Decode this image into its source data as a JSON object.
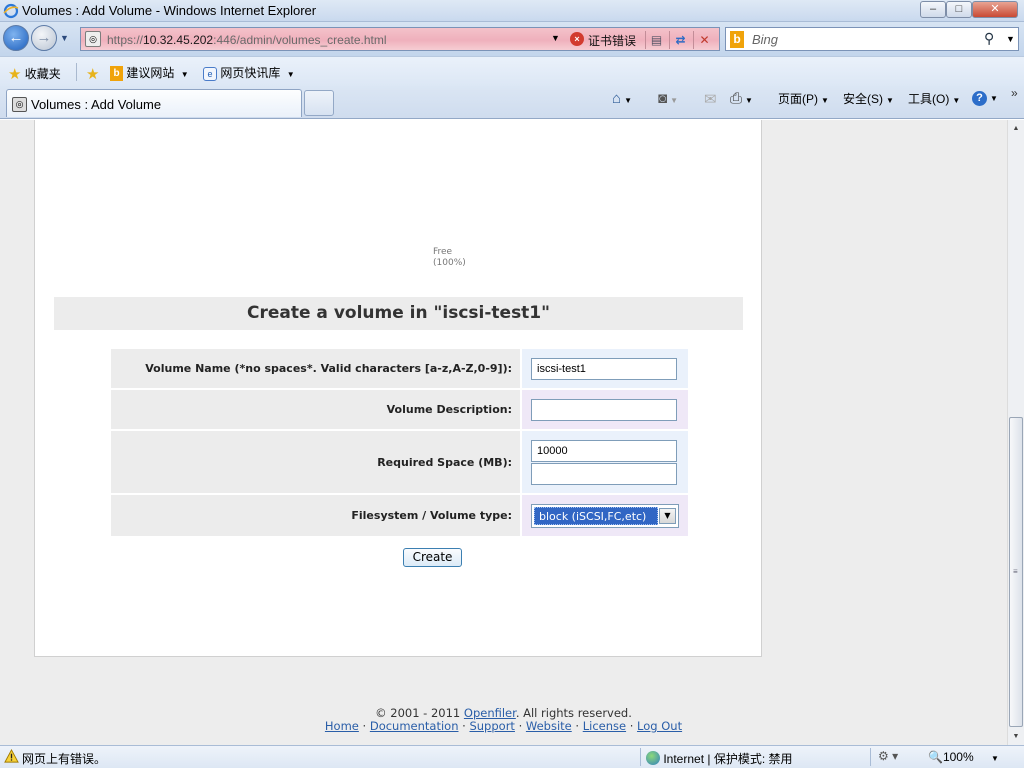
{
  "window": {
    "title": "Volumes : Add Volume - Windows Internet Explorer",
    "min": "–",
    "max": "□",
    "close": "✕"
  },
  "address": {
    "url_proto": "https://",
    "url_host": "10.32.45.202",
    "url_rest": ":446/admin/volumes_create.html",
    "cert_error": "证书错误",
    "search_placeholder": "Bing"
  },
  "favorites": {
    "favorites_label": "收藏夹",
    "suggested_sites": "建议网站",
    "web_slice_gallery": "网页快讯库"
  },
  "tabs": {
    "active_title": "Volumes : Add Volume"
  },
  "commandbar": {
    "page_menu": "页面(P)",
    "safety_menu": "安全(S)",
    "tools_menu": "工具(O)",
    "help": "?"
  },
  "page": {
    "pie_label_line1": "Free",
    "pie_label_line2": "(100%)",
    "section_title": "Create a volume in \"iscsi-test1\"",
    "form": {
      "volume_name_label": "Volume Name (*no spaces*. Valid characters [a-z,A-Z,0-9]):",
      "volume_name_value": "iscsi-test1",
      "description_label": "Volume Description:",
      "description_value": "",
      "required_space_label": "Required Space (MB):",
      "required_space_value": "10000",
      "fs_type_label": "Filesystem / Volume type:",
      "fs_type_selected": "block (iSCSI,FC,etc)"
    },
    "create_button": "Create",
    "footer": {
      "copyright_prefix": "© 2001 - 2011 ",
      "copyright_link": "Openfiler",
      "copyright_suffix": ". All rights reserved.",
      "links": [
        "Home",
        "Documentation",
        "Support",
        "Website",
        "License",
        "Log Out"
      ],
      "separator": " · "
    }
  },
  "status": {
    "message": "网页上有错误。",
    "zone": "Internet | 保护模式: 禁用",
    "zoom": "100%"
  }
}
